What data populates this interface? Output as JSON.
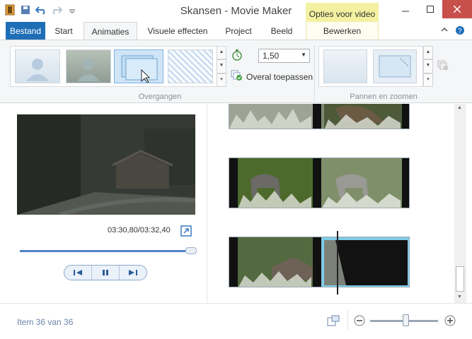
{
  "window": {
    "title": "Skansen - Movie Maker",
    "context_tab_header": "Opties voor video"
  },
  "tabs": [
    {
      "label": "Bestand"
    },
    {
      "label": "Start"
    },
    {
      "label": "Animaties"
    },
    {
      "label": "Visuele effecten"
    },
    {
      "label": "Project"
    },
    {
      "label": "Beeld"
    },
    {
      "label": "Bewerken"
    }
  ],
  "ribbon": {
    "transitions": {
      "group_label": "Overgangen",
      "duration_value": "1,50",
      "apply_all_label": "Overal toepassen"
    },
    "pan_zoom": {
      "group_label": "Pannen en zoomen"
    }
  },
  "preview": {
    "timecode": "03:30,80/03:32,40",
    "position_fraction": 0.99
  },
  "status": {
    "item_text": "Item 36 van 36"
  },
  "colors": {
    "file_tab": "#1e6eb7",
    "context_tab": "#f3f1a0",
    "accent": "#4f84c4",
    "close_button": "#c7504a"
  },
  "icons": {
    "qat": [
      "film-icon",
      "save-icon",
      "undo-icon",
      "redo-icon",
      "customize-icon"
    ],
    "window": [
      "minimize-icon",
      "maximize-icon",
      "close-icon"
    ]
  }
}
